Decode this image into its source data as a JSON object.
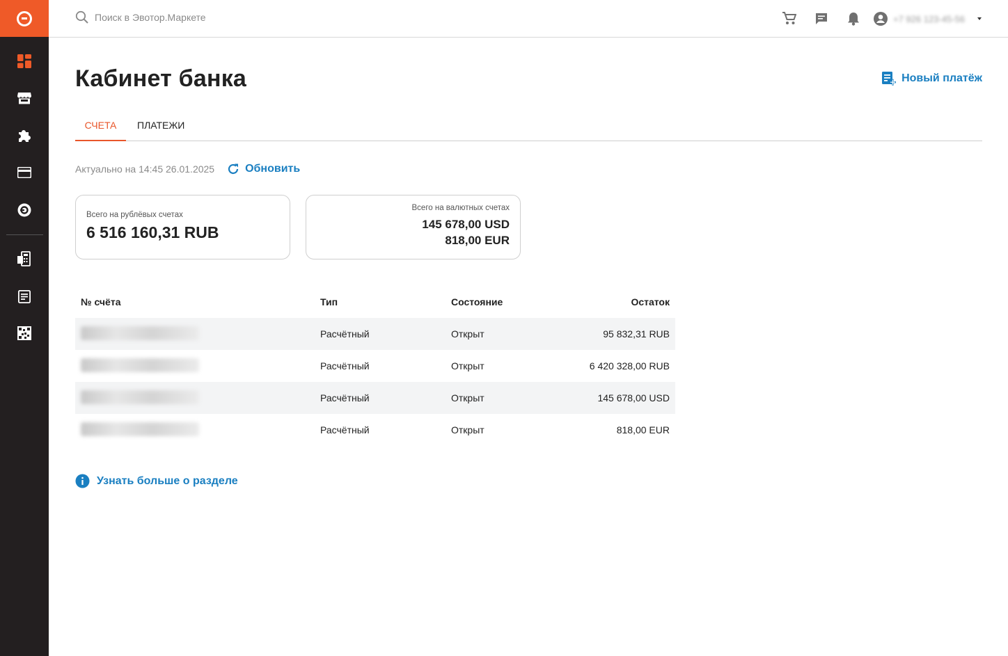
{
  "search": {
    "placeholder": "Поиск в Эвотор.Маркете"
  },
  "user": {
    "phone": "+7 926 123-45-56"
  },
  "page": {
    "title": "Кабинет банка",
    "new_payment_label": "Новый платёж"
  },
  "tabs": [
    {
      "label": "СЧЕТА",
      "active": true
    },
    {
      "label": "ПЛАТЕЖИ",
      "active": false
    }
  ],
  "status": {
    "actual": "Актуально на 14:45 26.01.2025",
    "refresh_label": "Обновить"
  },
  "cards": {
    "rub": {
      "label": "Всего на рублёвых счетах",
      "value": "6 516 160,31 RUB"
    },
    "currency": {
      "label": "Всего на валютных счетах",
      "usd": "145 678,00 USD",
      "eur": "818,00 EUR"
    }
  },
  "table": {
    "headers": {
      "account": "№ счёта",
      "type": "Тип",
      "state": "Состояние",
      "balance": "Остаток"
    },
    "rows": [
      {
        "type": "Расчётный",
        "state": "Открыт",
        "balance": "95 832,31 RUB"
      },
      {
        "type": "Расчётный",
        "state": "Открыт",
        "balance": "6 420 328,00 RUB"
      },
      {
        "type": "Расчётный",
        "state": "Открыт",
        "balance": "145 678,00 USD"
      },
      {
        "type": "Расчётный",
        "state": "Открыт",
        "balance": "818,00 EUR"
      }
    ]
  },
  "learn_more": "Узнать больше о разделе",
  "colors": {
    "accent": "#ef5a28",
    "link": "#1a7fc1",
    "sidebar": "#231f20"
  },
  "icons": {
    "sidebar": [
      "dashboard-icon",
      "store-icon",
      "puzzle-icon",
      "card-icon",
      "evotor-icon",
      "cash-register-icon",
      "receipt-icon",
      "qr-code-icon"
    ],
    "topbar": [
      "search-icon",
      "cart-icon",
      "chat-icon",
      "bell-icon",
      "account-icon"
    ]
  }
}
